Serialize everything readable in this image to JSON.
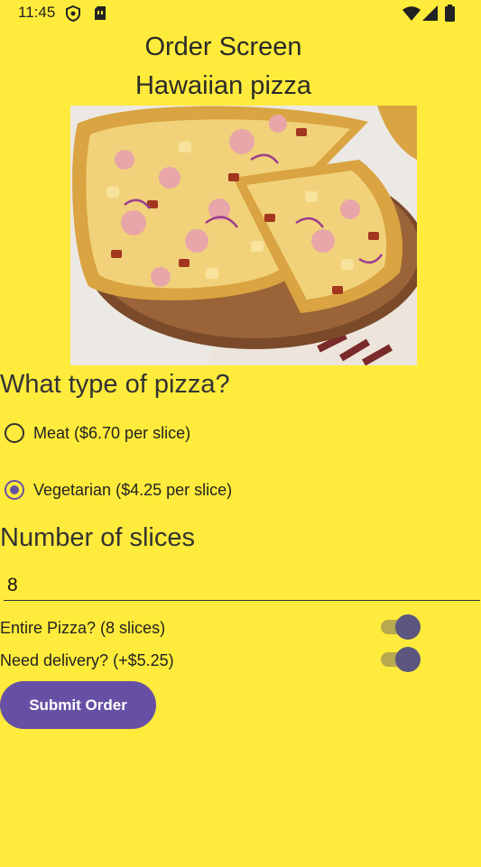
{
  "status_bar": {
    "time": "11:45",
    "left_icons": [
      "shield-icon",
      "sim-card-icon"
    ],
    "right_icons": [
      "wifi-icon",
      "signal-icon",
      "battery-icon"
    ]
  },
  "screen": {
    "title": "Order Screen",
    "subtitle": "Hawaiian pizza"
  },
  "pizza_image": {
    "alt": "Hawaiian pizza"
  },
  "pizza_type": {
    "heading": "What type of pizza?",
    "options": [
      {
        "label": "Meat ($6.70 per slice)",
        "selected": false
      },
      {
        "label": "Vegetarian ($4.25 per slice)",
        "selected": true
      }
    ]
  },
  "slices": {
    "heading": "Number of slices",
    "value": "8"
  },
  "switches": [
    {
      "label": "Entire Pizza? (8 slices)",
      "on": true
    },
    {
      "label": "Need delivery? (+$5.25)",
      "on": true
    }
  ],
  "submit": {
    "label": "Submit Order"
  },
  "colors": {
    "background": "#FFEB3B",
    "accent": "#6750A4",
    "switch_thumb": "#5C5680"
  }
}
